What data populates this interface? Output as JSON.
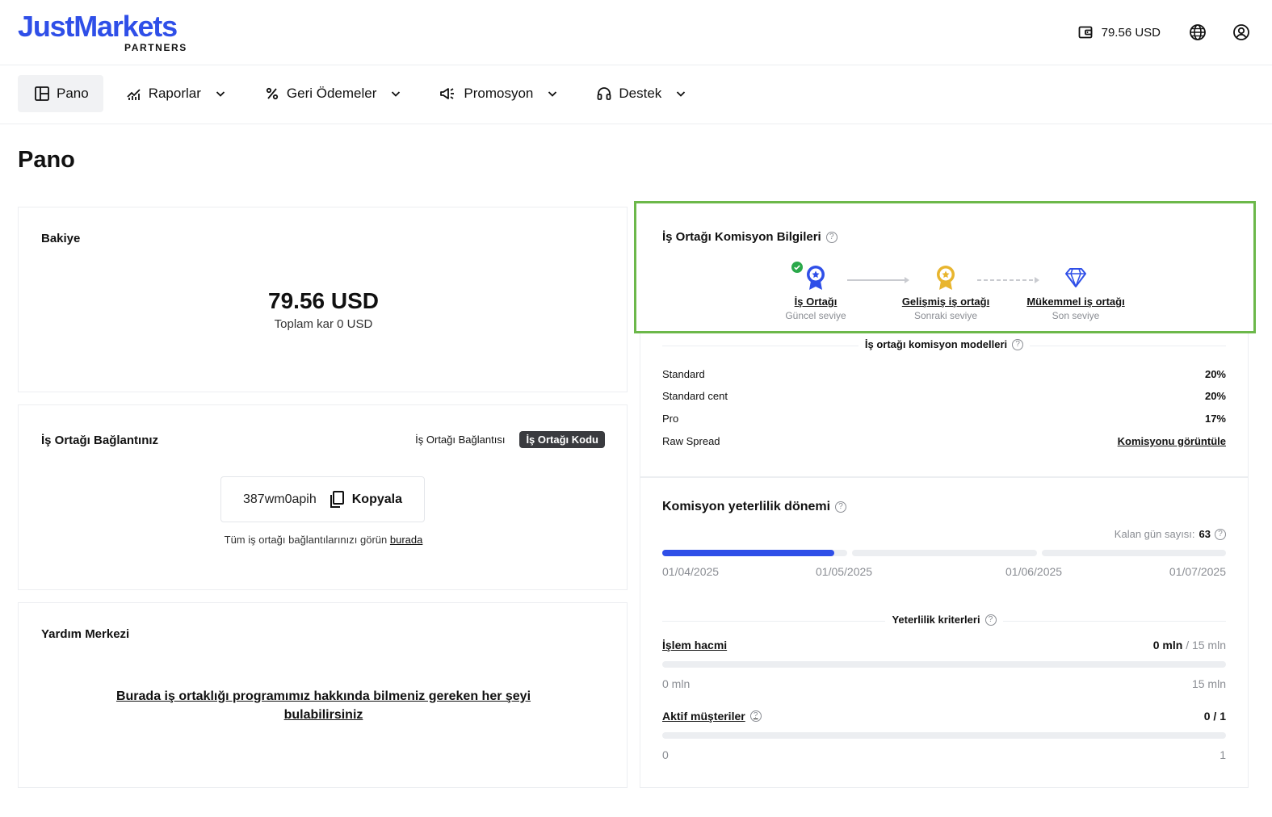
{
  "brand": {
    "name": "JustMarkets",
    "sub": "PARTNERS",
    "color": "#2f4fe8"
  },
  "header": {
    "balance": "79.56 USD",
    "icons": [
      "wallet-icon",
      "globe-icon",
      "user-icon"
    ]
  },
  "nav": {
    "items": [
      {
        "label": "Pano",
        "icon": "dashboard-icon",
        "active": true
      },
      {
        "label": "Raporlar",
        "icon": "chart-icon",
        "dropdown": true
      },
      {
        "label": "Geri Ödemeler",
        "icon": "percent-icon",
        "dropdown": true
      },
      {
        "label": "Promosyon",
        "icon": "megaphone-icon",
        "dropdown": true
      },
      {
        "label": "Destek",
        "icon": "headset-icon",
        "dropdown": true
      }
    ]
  },
  "page": {
    "title": "Pano"
  },
  "balance_card": {
    "title": "Bakiye",
    "amount": "79.56 USD",
    "sub": "Toplam kar 0 USD"
  },
  "link_card": {
    "title": "İş Ortağı Bağlantınız",
    "toggle": [
      "İş Ortağı Bağlantısı",
      "İş Ortağı Kodu"
    ],
    "code": "387wm0apih",
    "copy_label": "Kopyala",
    "footer_text": "Tüm iş ortağı bağlantılarınızı görün",
    "footer_link": "burada"
  },
  "help_card": {
    "title": "Yardım Merkezi",
    "link_line1": "Burada iş ortaklığı programımız hakkında bilmeniz gereken her şeyi",
    "link_line2": "bulabilirsiniz"
  },
  "commission": {
    "title": "İş Ortağı Komisyon Bilgileri",
    "levels": [
      {
        "name": "İş Ortağı",
        "sub": "Güncel seviye",
        "icon": "badge-blue-icon"
      },
      {
        "name": "Gelişmiş iş ortağı",
        "sub": "Sonraki seviye",
        "icon": "badge-gold-icon"
      },
      {
        "name": "Mükemmel iş ortağı",
        "sub": "Son seviye",
        "icon": "diamond-icon"
      }
    ],
    "models_title": "İş ortağı komisyon modelleri",
    "models": [
      {
        "name": "Standard",
        "value": "20%"
      },
      {
        "name": "Standard cent",
        "value": "20%"
      },
      {
        "name": "Pro",
        "value": "17%"
      },
      {
        "name": "Raw Spread",
        "value": "Komisyonu görüntüle"
      }
    ]
  },
  "period": {
    "title": "Komisyon yeterlilik dönemi",
    "days_label": "Kalan gün sayısı:",
    "days_value": "63",
    "dates": [
      "01/04/2025",
      "01/05/2025",
      "01/06/2025",
      "01/07/2025"
    ],
    "progress_first_segment": 0.93,
    "criteria_title": "Yeterlilik kriterleri",
    "criteria": [
      {
        "name": "İşlem hacmi",
        "current": "0 mln",
        "target": "/ 15 mln",
        "min": "0 mln",
        "max": "15 mln",
        "progress": 0
      },
      {
        "name": "Aktif müşteriler",
        "current": "0 / 1",
        "target": "",
        "min": "0",
        "max": "1",
        "progress": 0
      }
    ]
  },
  "colors": {
    "accent": "#2f4fe8",
    "highlight": "#6cb84a",
    "gold": "#e8b52e",
    "check": "#2aa84a"
  }
}
